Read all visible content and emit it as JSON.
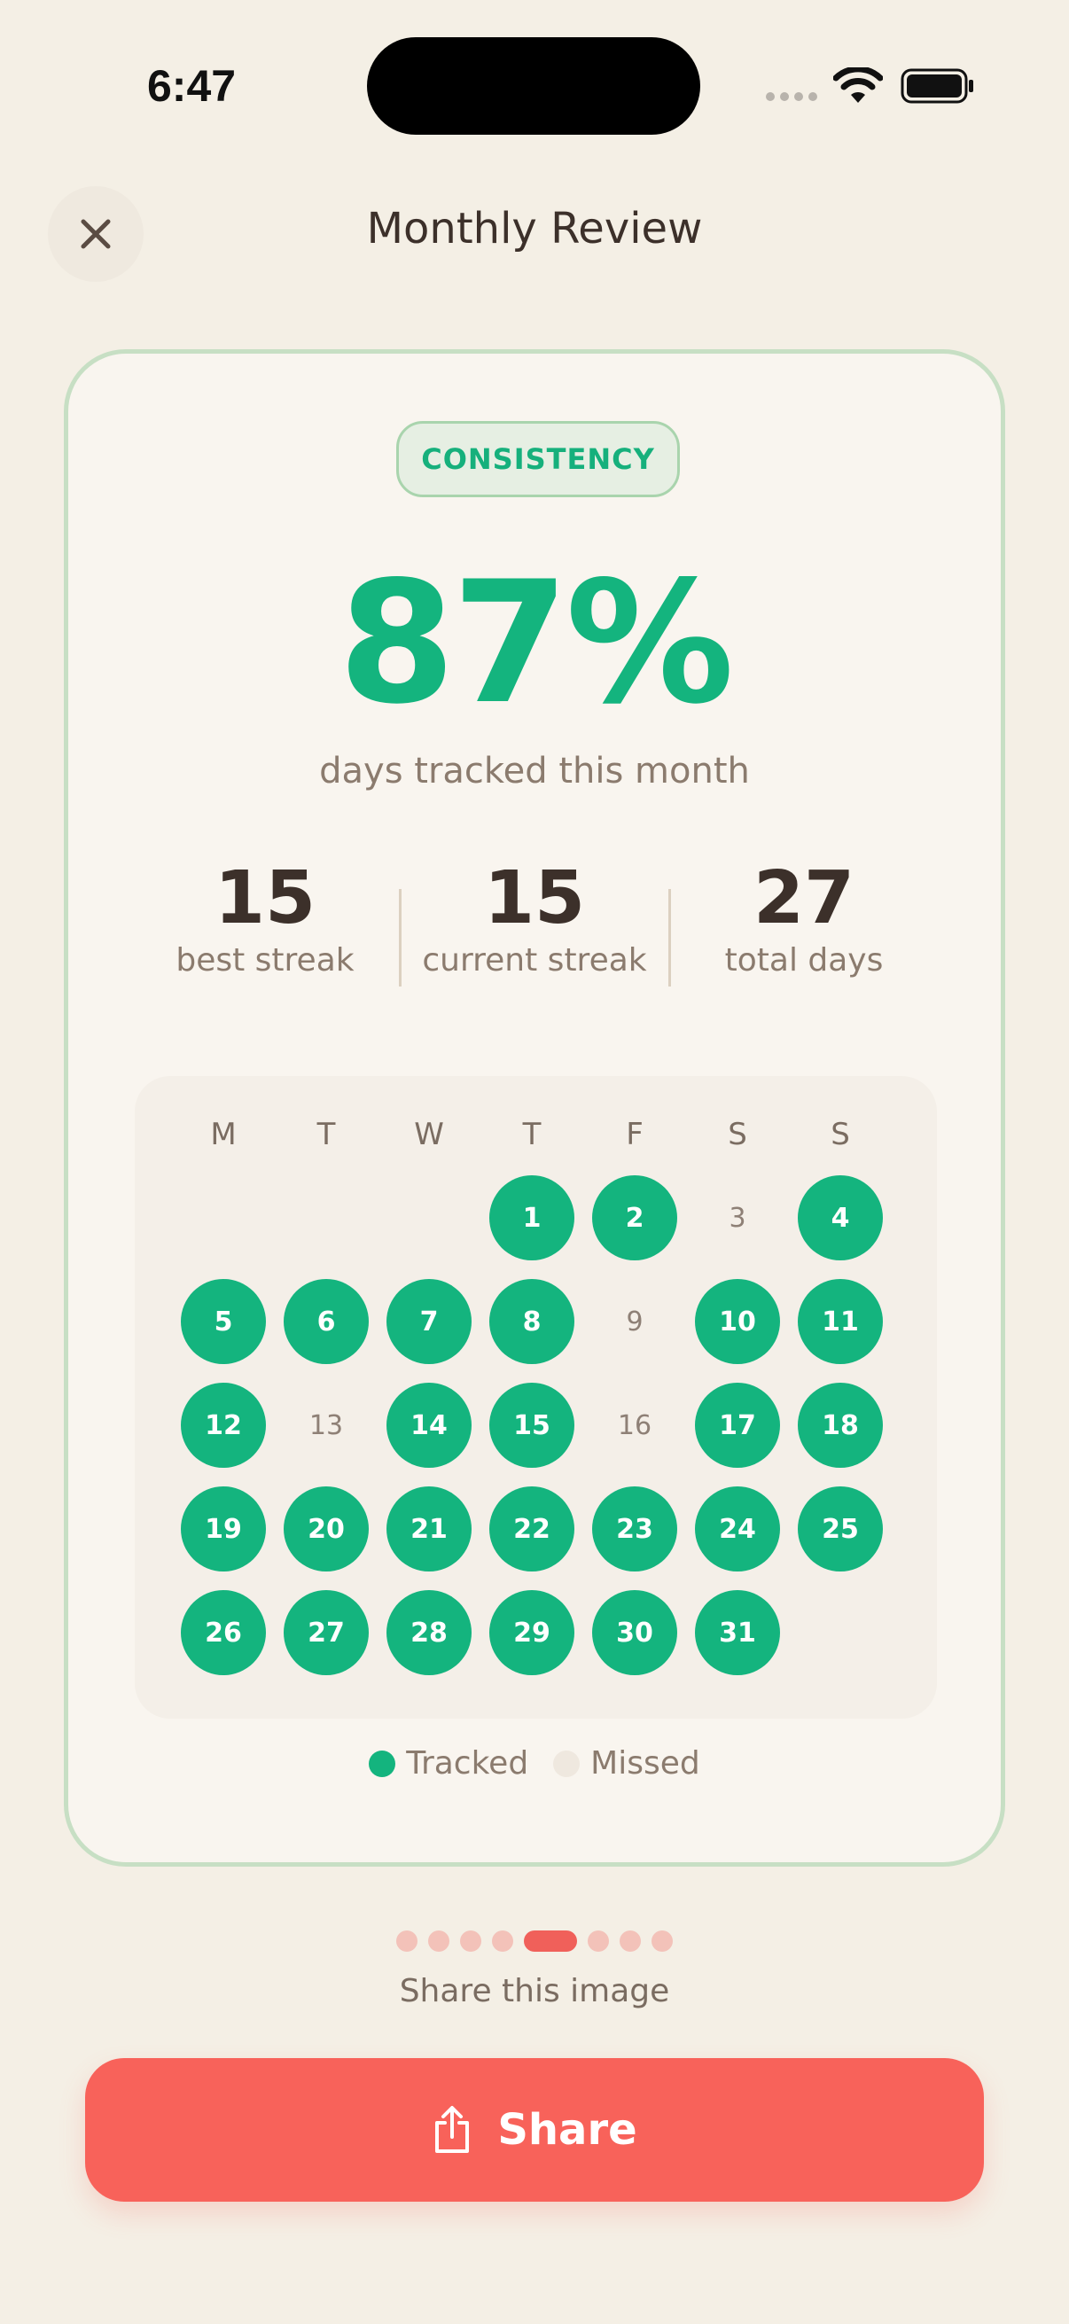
{
  "status_bar": {
    "time": "6:47"
  },
  "header": {
    "title": "Monthly Review"
  },
  "card": {
    "badge": "CONSISTENCY",
    "percent": "87%",
    "percent_label": "days tracked this month",
    "stats": [
      {
        "value": "15",
        "label": "best streak"
      },
      {
        "value": "15",
        "label": "current streak"
      },
      {
        "value": "27",
        "label": "total days"
      }
    ],
    "calendar": {
      "weekdays": [
        "M",
        "T",
        "W",
        "T",
        "F",
        "S",
        "S"
      ],
      "first_weekday_index": 3,
      "days": [
        {
          "n": "1",
          "tracked": true
        },
        {
          "n": "2",
          "tracked": true
        },
        {
          "n": "3",
          "tracked": false
        },
        {
          "n": "4",
          "tracked": true
        },
        {
          "n": "5",
          "tracked": true
        },
        {
          "n": "6",
          "tracked": true
        },
        {
          "n": "7",
          "tracked": true
        },
        {
          "n": "8",
          "tracked": true
        },
        {
          "n": "9",
          "tracked": false
        },
        {
          "n": "10",
          "tracked": true
        },
        {
          "n": "11",
          "tracked": true
        },
        {
          "n": "12",
          "tracked": true
        },
        {
          "n": "13",
          "tracked": false
        },
        {
          "n": "14",
          "tracked": true
        },
        {
          "n": "15",
          "tracked": true
        },
        {
          "n": "16",
          "tracked": false
        },
        {
          "n": "17",
          "tracked": true
        },
        {
          "n": "18",
          "tracked": true
        },
        {
          "n": "19",
          "tracked": true
        },
        {
          "n": "20",
          "tracked": true
        },
        {
          "n": "21",
          "tracked": true
        },
        {
          "n": "22",
          "tracked": true
        },
        {
          "n": "23",
          "tracked": true
        },
        {
          "n": "24",
          "tracked": true
        },
        {
          "n": "25",
          "tracked": true
        },
        {
          "n": "26",
          "tracked": true
        },
        {
          "n": "27",
          "tracked": true
        },
        {
          "n": "28",
          "tracked": true
        },
        {
          "n": "29",
          "tracked": true
        },
        {
          "n": "30",
          "tracked": true
        },
        {
          "n": "31",
          "tracked": true
        }
      ]
    },
    "legend": {
      "tracked": "Tracked",
      "missed": "Missed"
    }
  },
  "pager": {
    "count": 8,
    "active_index": 4
  },
  "share_hint": "Share this image",
  "share_button": {
    "label": "Share"
  },
  "colors": {
    "accent_green": "#14b47e",
    "accent_red": "#f8625a",
    "background": "#f4efe5"
  }
}
